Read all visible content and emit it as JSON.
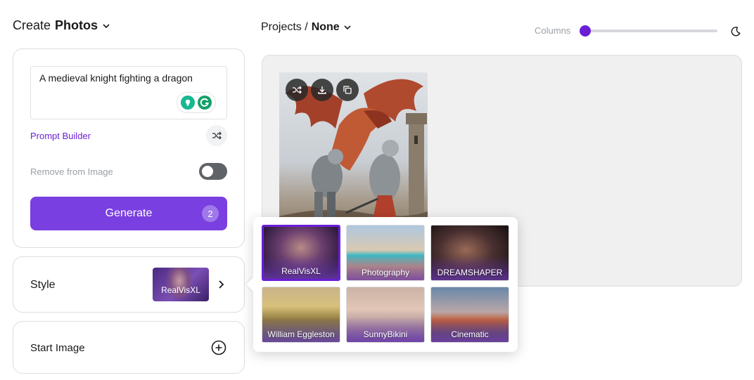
{
  "header": {
    "create_prefix": "Create",
    "create_mode": "Photos",
    "projects_label": "Projects /",
    "projects_value": "None",
    "columns_label": "Columns",
    "columns_value": 0
  },
  "prompt": {
    "text": "A medieval knight fighting a dragon",
    "builder_label": "Prompt Builder",
    "remove_label": "Remove from Image",
    "remove_enabled": false,
    "generate_label": "Generate",
    "generate_count": "2"
  },
  "style": {
    "label": "Style",
    "selected": "RealVisXL",
    "options": [
      {
        "label": "RealVisXL",
        "selected": true
      },
      {
        "label": "Photography",
        "selected": false
      },
      {
        "label": "DREAMSHAPER",
        "selected": false
      },
      {
        "label": "William Eggleston",
        "selected": false
      },
      {
        "label": "SunnyBikini",
        "selected": false
      },
      {
        "label": "Cinematic",
        "selected": false
      }
    ]
  },
  "start_image": {
    "label": "Start Image"
  },
  "colors": {
    "accent": "#6a1fd6",
    "generate": "#7a3fe0",
    "toggle_off": "#5f6368"
  },
  "icons": {
    "image_actions": [
      "shuffle-icon",
      "download-icon",
      "copy-icon"
    ],
    "theme": "moon-icon"
  }
}
